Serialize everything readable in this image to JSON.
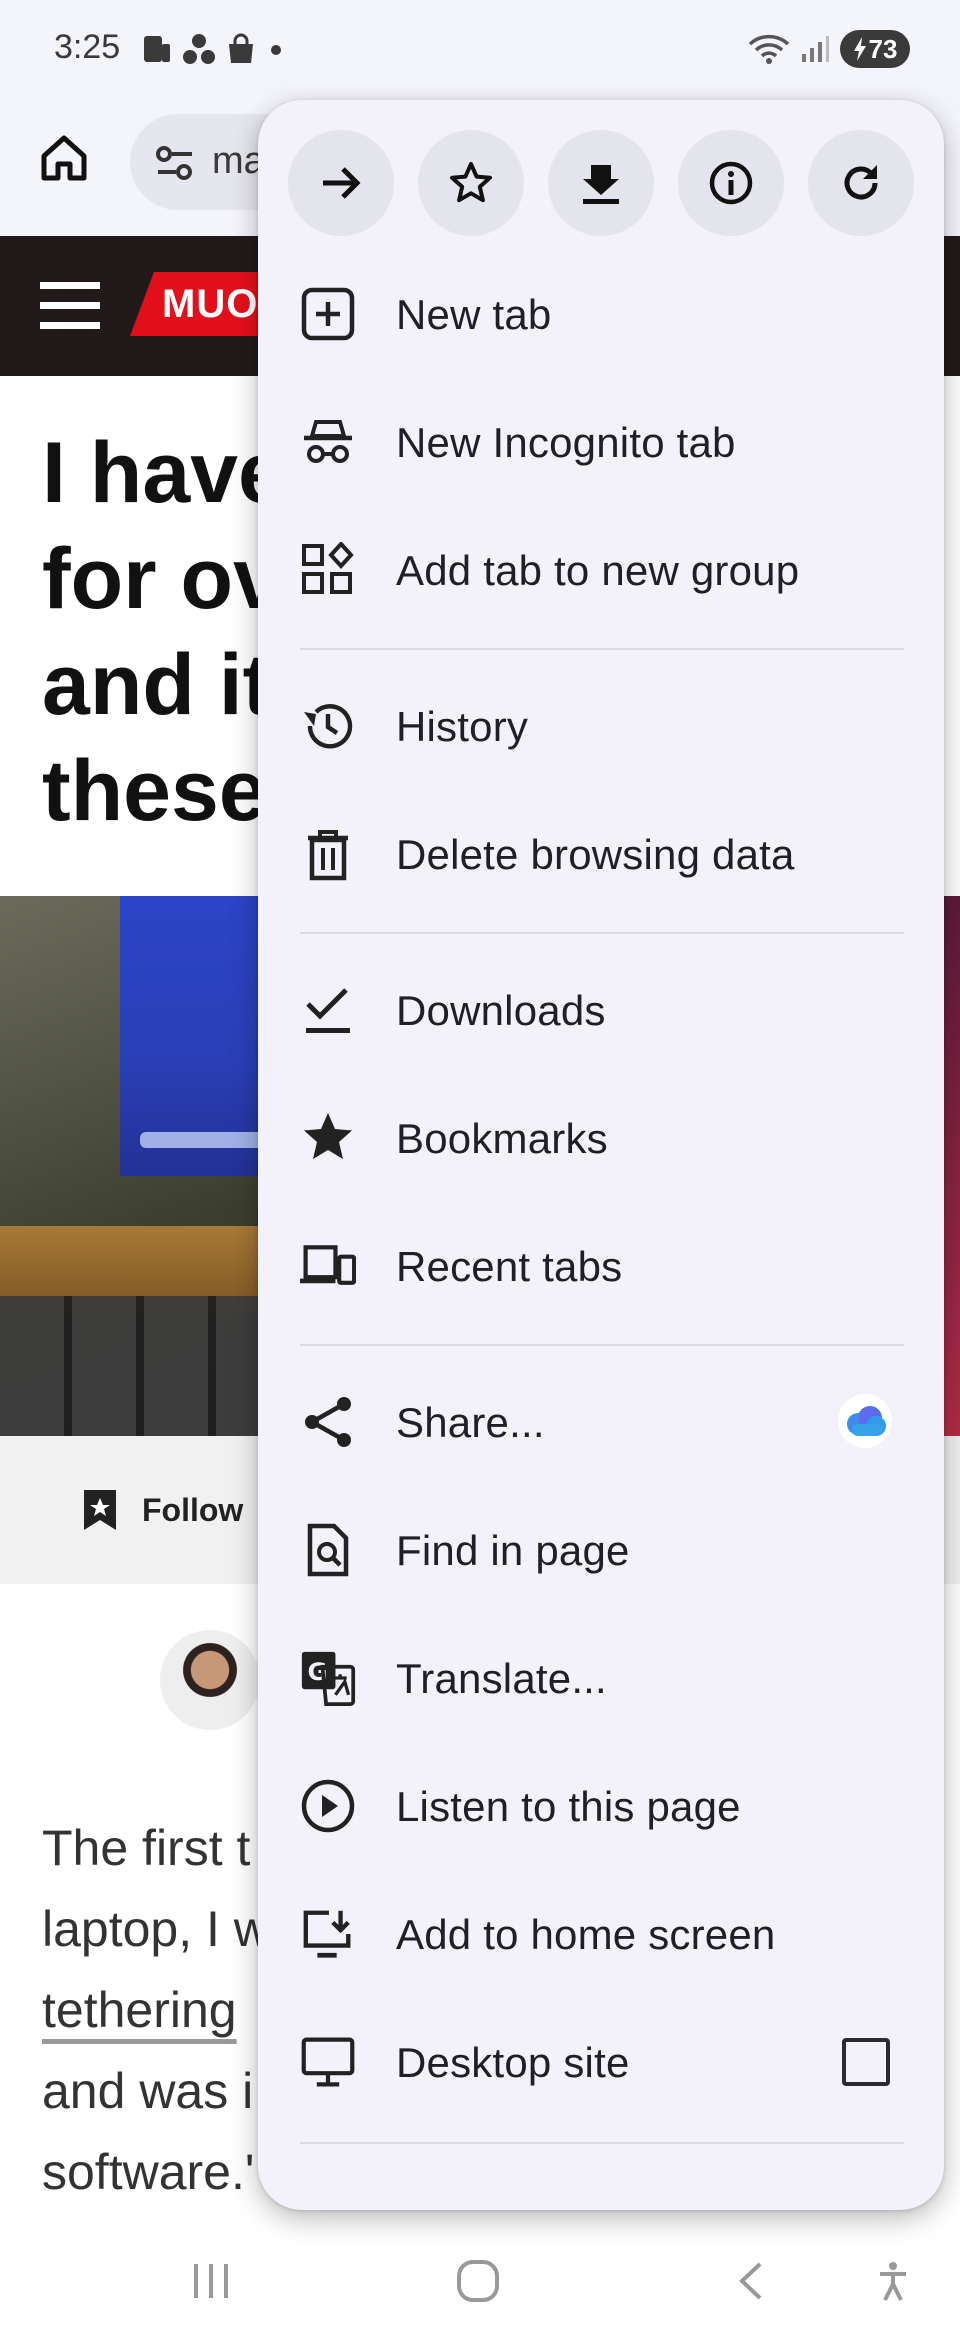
{
  "status_bar": {
    "time": "3:25",
    "battery": "73"
  },
  "toolbar": {
    "omnibox_text": "ma"
  },
  "site": {
    "logo_text": "MUO"
  },
  "article": {
    "title_lines": [
      "I have",
      "for ov",
      "and it",
      "these"
    ],
    "follow_label": "Follow",
    "body_lines": [
      "The first t",
      "laptop, I w",
      "tethering",
      "and was i",
      "software.'"
    ]
  },
  "menu": {
    "top_actions": [
      {
        "icon": "forward-icon"
      },
      {
        "icon": "bookmark-star-icon"
      },
      {
        "icon": "download-icon"
      },
      {
        "icon": "page-info-icon"
      },
      {
        "icon": "refresh-icon"
      }
    ],
    "items": [
      {
        "label": "New tab",
        "icon": "new-tab-icon"
      },
      {
        "label": "New Incognito tab",
        "icon": "incognito-icon"
      },
      {
        "label": "Add tab to new group",
        "icon": "tab-group-icon"
      },
      {
        "label": "History",
        "icon": "history-icon"
      },
      {
        "label": "Delete browsing data",
        "icon": "trash-icon"
      },
      {
        "label": "Downloads",
        "icon": "downloads-icon"
      },
      {
        "label": "Bookmarks",
        "icon": "bookmarks-star-icon"
      },
      {
        "label": "Recent tabs",
        "icon": "devices-icon"
      },
      {
        "label": "Share...",
        "icon": "share-icon"
      },
      {
        "label": "Find in page",
        "icon": "find-in-page-icon"
      },
      {
        "label": "Translate...",
        "icon": "translate-icon"
      },
      {
        "label": "Listen to this page",
        "icon": "play-circle-icon"
      },
      {
        "label": "Add to home screen",
        "icon": "add-to-home-icon"
      },
      {
        "label": "Desktop site",
        "icon": "desktop-icon",
        "checked": false
      }
    ]
  },
  "colors": {
    "menu_bg": "#f3f2fa",
    "brand_red": "#e3101b",
    "header_dark": "#221a1a"
  }
}
